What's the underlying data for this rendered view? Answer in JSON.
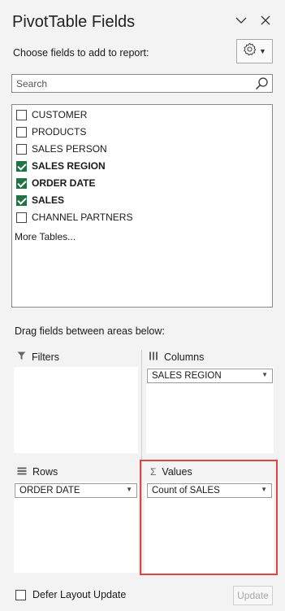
{
  "pane": {
    "title": "PivotTable Fields",
    "choose_label": "Choose fields to add to report:"
  },
  "search": {
    "placeholder": "Search",
    "value": ""
  },
  "fields": [
    {
      "label": "CUSTOMER",
      "checked": false
    },
    {
      "label": "PRODUCTS",
      "checked": false
    },
    {
      "label": "SALES PERSON",
      "checked": false
    },
    {
      "label": "SALES REGION",
      "checked": true
    },
    {
      "label": "ORDER DATE",
      "checked": true
    },
    {
      "label": "SALES",
      "checked": true
    },
    {
      "label": "CHANNEL PARTNERS",
      "checked": false
    }
  ],
  "more_tables": "More Tables...",
  "areas": {
    "drag_label": "Drag fields between areas below:",
    "filters": {
      "title": "Filters"
    },
    "columns": {
      "title": "Columns",
      "items": [
        "SALES REGION"
      ]
    },
    "rows": {
      "title": "Rows",
      "items": [
        "ORDER DATE"
      ]
    },
    "values": {
      "title": "Values",
      "items": [
        "Count of SALES"
      ]
    }
  },
  "footer": {
    "defer_label": "Defer Layout Update",
    "update_label": "Update"
  },
  "colors": {
    "checked": "#217346",
    "highlight": "#e04545"
  }
}
